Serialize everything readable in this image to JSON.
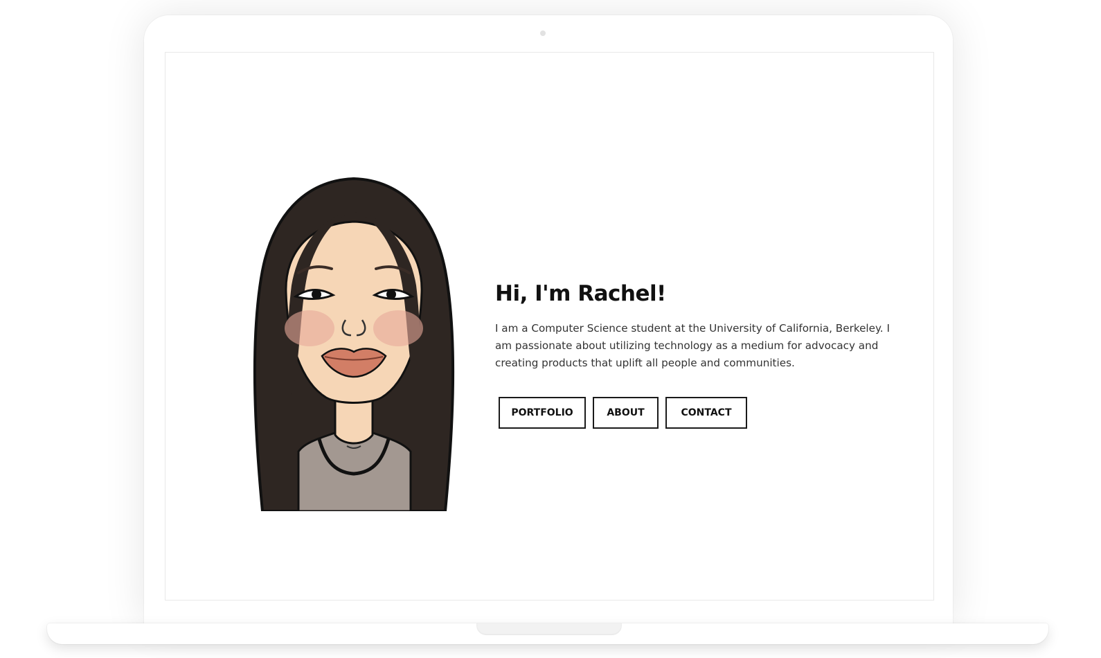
{
  "hero": {
    "title": "Hi, I'm Rachel!",
    "description": "I am a Computer Science student at the University of California, Berkeley. I am passionate about utilizing technology as a medium for advocacy and creating products that uplift all people and communities."
  },
  "buttons": {
    "portfolio": "PORTFOLIO",
    "about": "ABOUT",
    "contact": "CONTACT"
  },
  "colors": {
    "hair": "#2e2622",
    "skin": "#f6d6b6",
    "blush": "#e8a89a",
    "lips": "#d27e66",
    "shirt": "#a39891",
    "text": "#111111",
    "border": "#1a1a1a"
  },
  "icons": {
    "avatar": "caricature-portrait"
  }
}
